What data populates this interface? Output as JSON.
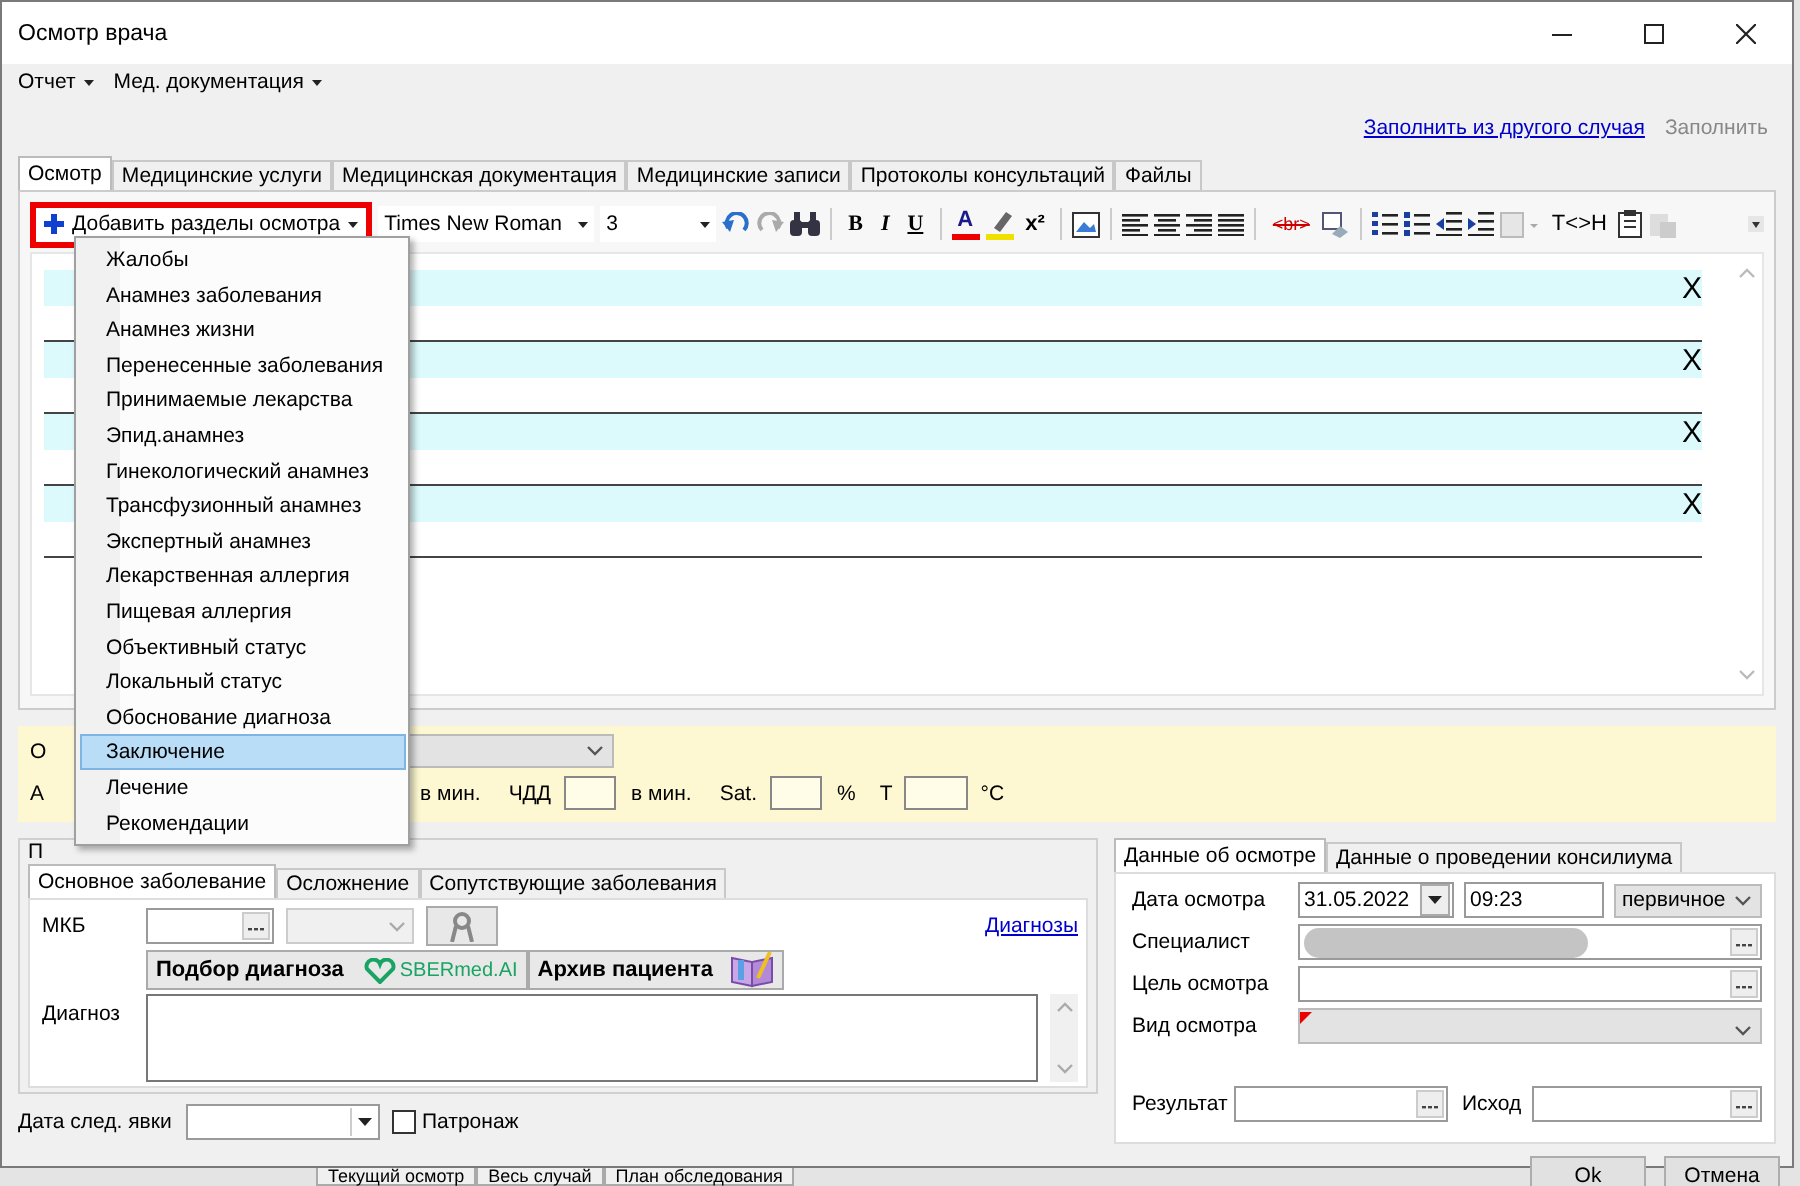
{
  "window": {
    "title": "Осмотр врача"
  },
  "menu_bar": [
    {
      "label": "Отчет"
    },
    {
      "label": "Мед. документация"
    }
  ],
  "top_links": {
    "fill_from_other_case": "Заполнить из другого случая",
    "fill": {
      "label": "Заполнить",
      "disabled": true
    }
  },
  "tabs": [
    {
      "label": "Осмотр",
      "selected": true
    },
    {
      "label": "Медицинские услуги",
      "selected": false
    },
    {
      "label": "Медицинская документация",
      "selected": false
    },
    {
      "label": "Медицинские записи",
      "selected": false
    },
    {
      "label": "Протоколы консультаций",
      "selected": false
    },
    {
      "label": "Файлы",
      "selected": false
    }
  ],
  "toolbar": {
    "add_sections_button": "Добавить разделы осмотра",
    "font": "Times New Roman",
    "size": "3",
    "bold": "B",
    "italic": "I",
    "underline": "U",
    "text_color": "A",
    "superscript": "x²",
    "remove_breaks": "<br>",
    "tags_toggle": "T<>H"
  },
  "editor": {
    "sections": [
      {
        "close": "X"
      },
      {
        "close": "X"
      },
      {
        "close": "X"
      },
      {
        "close": "X"
      }
    ]
  },
  "sections_menu": {
    "items": [
      {
        "label": "Жалобы",
        "selected": false
      },
      {
        "label": "Анамнез заболевания",
        "selected": false
      },
      {
        "label": "Анамнез жизни",
        "selected": false
      },
      {
        "label": "Перенесенные заболевания",
        "selected": false
      },
      {
        "label": "Принимаемые лекарства",
        "selected": false
      },
      {
        "label": "Эпид.анамнез",
        "selected": false
      },
      {
        "label": "Гинекологический анамнез",
        "selected": false
      },
      {
        "label": "Трансфузионный анамнез",
        "selected": false
      },
      {
        "label": "Экспертный анамнез",
        "selected": false
      },
      {
        "label": "Лекарственная аллергия",
        "selected": false
      },
      {
        "label": "Пищевая аллергия",
        "selected": false
      },
      {
        "label": "Объективный статус",
        "selected": false
      },
      {
        "label": "Локальный статус",
        "selected": false
      },
      {
        "label": "Обоснование диагноза",
        "selected": false
      },
      {
        "label": "Заключение",
        "selected": true
      },
      {
        "label": "Лечение",
        "selected": false
      },
      {
        "label": "Рекомендации",
        "selected": false
      }
    ]
  },
  "vitals": {
    "row_1_label": "О",
    "row_2_label": "А",
    "pulse_unit": "в мин.",
    "rr_label": "ЧДД",
    "rr_unit": "в мин.",
    "sat_label": "Sat.",
    "sat_unit": "%",
    "temp_label": "T",
    "temp_unit": "°C"
  },
  "diagnosis_panel": {
    "title": "П",
    "tabs": [
      {
        "label": "Основное заболевание",
        "selected": true
      },
      {
        "label": "Осложнение",
        "selected": false
      },
      {
        "label": "Сопутствующие заболевания",
        "selected": false
      }
    ],
    "mkb_label": "МКБ",
    "diagnoses_link": "Диагнозы",
    "pick_button": "Подбор диагноза",
    "ai_logo": "SBERmed.AI",
    "archive_button": "Архив пациента",
    "diagnosis_label": "Диагноз"
  },
  "next_visit": {
    "label": "Дата след. явки",
    "patronage": {
      "label": "Патронаж",
      "checked": false
    }
  },
  "exam_panel": {
    "tabs": [
      {
        "label": "Данные об осмотре",
        "selected": true
      },
      {
        "label": "Данные о проведении консилиума",
        "selected": false
      }
    ],
    "date_label": "Дата осмотра",
    "date": "31.05.2022",
    "time": "09:23",
    "visit_type": "первичное",
    "specialist_label": "Специалист",
    "purpose_label": "Цель осмотра",
    "kind_label": "Вид осмотра",
    "kind_required": true,
    "result_label": "Результат",
    "outcome_label": "Исход"
  },
  "buttons": [
    "Ok",
    "Отмена"
  ],
  "background_tabs": [
    "Текущий осмотр",
    "Весь случай",
    "План обследования"
  ]
}
